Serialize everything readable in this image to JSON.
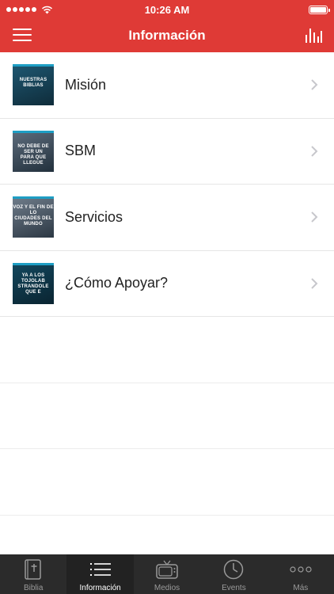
{
  "status_bar": {
    "time": "10:26 AM"
  },
  "nav": {
    "title": "Información"
  },
  "list": {
    "items": [
      {
        "label": "Misión",
        "thumb_text": "NUESTRAS BIBLIAS",
        "thumb_bg": "#153a4d"
      },
      {
        "label": "SBM",
        "thumb_text": "NO DEBE DE SER UN\nPARA QUE LLEGUE",
        "thumb_bg": "#2d3b4a"
      },
      {
        "label": "Servicios",
        "thumb_text": "VOZ Y EL FIN DE LO\nCIUDADES DEL MUNDO",
        "thumb_bg": "#3a4a5a"
      },
      {
        "label": "¿Cómo Apoyar?",
        "thumb_text": "YA A LOS TOJOLAB\nSTRANDOLE QUE E",
        "thumb_bg": "#0f3345"
      }
    ]
  },
  "tab_bar": {
    "tabs": [
      {
        "label": "Biblia",
        "icon": "bible-icon"
      },
      {
        "label": "Información",
        "icon": "list-icon"
      },
      {
        "label": "Medios",
        "icon": "tv-icon"
      },
      {
        "label": "Events",
        "icon": "clock-icon"
      },
      {
        "label": "Más",
        "icon": "more-icon"
      }
    ],
    "active_index": 1
  },
  "colors": {
    "header_red": "#df3a36",
    "tab_bar_bg": "#2b2b2b",
    "thumb_accent": "#1e9ec4"
  }
}
